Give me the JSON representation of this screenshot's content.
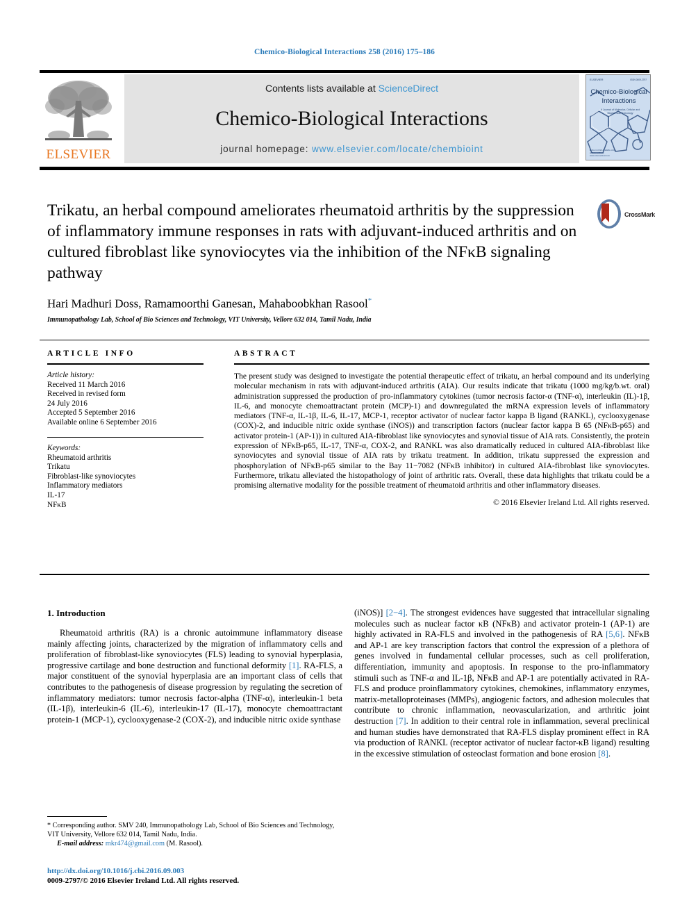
{
  "running_head": "Chemico-Biological Interactions 258 (2016) 175–186",
  "masthead": {
    "publisher_name": "ELSEVIER",
    "publisher_logo_icon": "elsevier-tree-icon",
    "contents_prefix": "Contents lists available at ",
    "contents_link": "ScienceDirect",
    "journal_title": "Chemico-Biological Interactions",
    "homepage_label": "journal homepage: ",
    "homepage_url": "www.elsevier.com/locate/chembioint",
    "cover": {
      "title_line1": "Chemico-Biological",
      "title_line2": "Interactions",
      "subtitle": "A Journal of Molecular, Cellular and Biochemical Toxicology",
      "brand": "ELSEVIER",
      "issn": "ISSN 0009-2797",
      "footer": "Editor-in-Chief   Available online at   ScienceDirect   www.sciencedirect.com"
    }
  },
  "article": {
    "title": "Trikatu, an herbal compound ameliorates rheumatoid arthritis by the suppression of inflammatory immune responses in rats with adjuvant-induced arthritis and on cultured fibroblast like synoviocytes via the inhibition of the NFκB signaling pathway",
    "authors": "Hari Madhuri Doss, Ramamoorthi Ganesan, Mahaboobkhan Rasool",
    "corresponding_marker": "*",
    "affiliation": "Immunopathology Lab, School of Bio Sciences and Technology, VIT University, Vellore 632 014, Tamil Nadu, India",
    "crossmark_label": "CrossMark",
    "crossmark_icon": "crossmark-icon"
  },
  "article_info": {
    "heading": "ARTICLE INFO",
    "history_label": "Article history:",
    "history": [
      "Received 11 March 2016",
      "Received in revised form",
      "24 July 2016",
      "Accepted 5 September 2016",
      "Available online 6 September 2016"
    ],
    "keywords_label": "Keywords:",
    "keywords": [
      "Rheumatoid arthritis",
      "Trikatu",
      "Fibroblast-like synoviocytes",
      "Inflammatory mediators",
      "IL-17",
      "NFκB"
    ]
  },
  "abstract": {
    "heading": "ABSTRACT",
    "text": "The present study was designed to investigate the potential therapeutic effect of trikatu, an herbal compound and its underlying molecular mechanism in rats with adjuvant-induced arthritis (AIA). Our results indicate that trikatu (1000 mg/kg/b.wt. oral) administration suppressed the production of pro-inflammatory cytokines (tumor necrosis factor-α (TNF-α), interleukin (IL)-1β, IL-6, and monocyte chemoattractant protein (MCP)-1) and downregulated the mRNA expression levels of inflammatory mediators (TNF-α, IL-1β, IL-6, IL-17, MCP-1, receptor activator of nuclear factor kappa B ligand (RANKL), cyclooxygenase (COX)-2, and inducible nitric oxide synthase (iNOS)) and transcription factors (nuclear factor kappa B 65 (NFκB-p65) and activator protein-1 (AP-1)) in cultured AIA-fibroblast like synoviocytes and synovial tissue of AIA rats. Consistently, the protein expression of NFκB-p65, IL-17, TNF-α, COX-2, and RANKL was also dramatically reduced in cultured AIA-fibroblast like synoviocytes and synovial tissue of AIA rats by trikatu treatment. In addition, trikatu suppressed the expression and phosphorylation of NFκB-p65 similar to the Bay 11−7082 (NFκB inhibitor) in cultured AIA-fibroblast like synoviocytes. Furthermore, trikatu alleviated the histopathology of joint of arthritic rats. Overall, these data highlights that trikatu could be a promising alternative modality for the possible treatment of rheumatoid arthritis and other inflammatory diseases.",
    "copyright": "© 2016 Elsevier Ireland Ltd. All rights reserved."
  },
  "introduction": {
    "heading": "1. Introduction",
    "left_para_1": "Rheumatoid arthritis (RA) is a chronic autoimmune inflammatory disease mainly affecting joints, characterized by the migration of inflammatory cells and proliferation of fibroblast-like synoviocytes (FLS) leading to synovial hyperplasia, progressive cartilage and bone destruction and functional deformity ",
    "left_ref_1": "[1]",
    "left_para_2": ". RA-FLS, a major constituent of the synovial hyperplasia are an important class of cells that contributes to the pathogenesis of disease progression by regulating the secretion of inflammatory mediators: tumor necrosis factor-alpha (TNF-α), interleukin-1 beta (IL-1β), interleukin-6 (IL-6), interleukin-17 (IL-17), monocyte chemoattractant protein-1 (MCP-1), cyclooxygenase-2 (COX-2), and inducible nitric oxide synthase",
    "right_chunk_1": "(iNOS)] ",
    "right_ref_1": "[2−4]",
    "right_chunk_2": ". The strongest evidences have suggested that intracellular signaling molecules such as nuclear factor κB (NFκB) and activator protein-1 (AP-1) are highly activated in RA-FLS and involved in the pathogenesis of RA ",
    "right_ref_2": "[5,6]",
    "right_chunk_3": ". NFκB and AP-1 are key transcription factors that control the expression of a plethora of genes involved in fundamental cellular processes, such as cell proliferation, differentiation, immunity and apoptosis. In response to the pro-inflammatory stimuli such as TNF-α and IL-1β, NFκB and AP-1 are potentially activated in RA-FLS and produce proinflammatory cytokines, chemokines, inflammatory enzymes, matrix-metalloproteinases (MMPs), angiogenic factors, and adhesion molecules that contribute to chronic inflammation, neovascularization, and arthritic joint destruction ",
    "right_ref_3": "[7]",
    "right_chunk_4": ". In addition to their central role in inflammation, several preclinical and human studies have demonstrated that RA-FLS display prominent effect in RA via production of RANKL (receptor activator of nuclear factor-κB ligand) resulting in the excessive stimulation of osteoclast formation and bone erosion ",
    "right_ref_4": "[8]",
    "right_chunk_5": "."
  },
  "footnote": {
    "star": "*",
    "text": " Corresponding author. SMV 240, Immunopathology Lab, School of Bio Sciences and Technology, VIT University, Vellore 632 014, Tamil Nadu, India.",
    "email_label": "E-mail address:",
    "email": "mkr474@gmail.com",
    "email_suffix": " (M. Rasool)."
  },
  "footer": {
    "doi": "http://dx.doi.org/10.1016/j.cbi.2016.09.003",
    "issn_line": "0009-2797/© 2016 Elsevier Ireland Ltd. All rights reserved."
  },
  "colors": {
    "link": "#2b7bb9",
    "elsevier_orange": "#E87722",
    "masthead_gray": "#e3e3e3",
    "cover_blue": "#cfdff0"
  }
}
